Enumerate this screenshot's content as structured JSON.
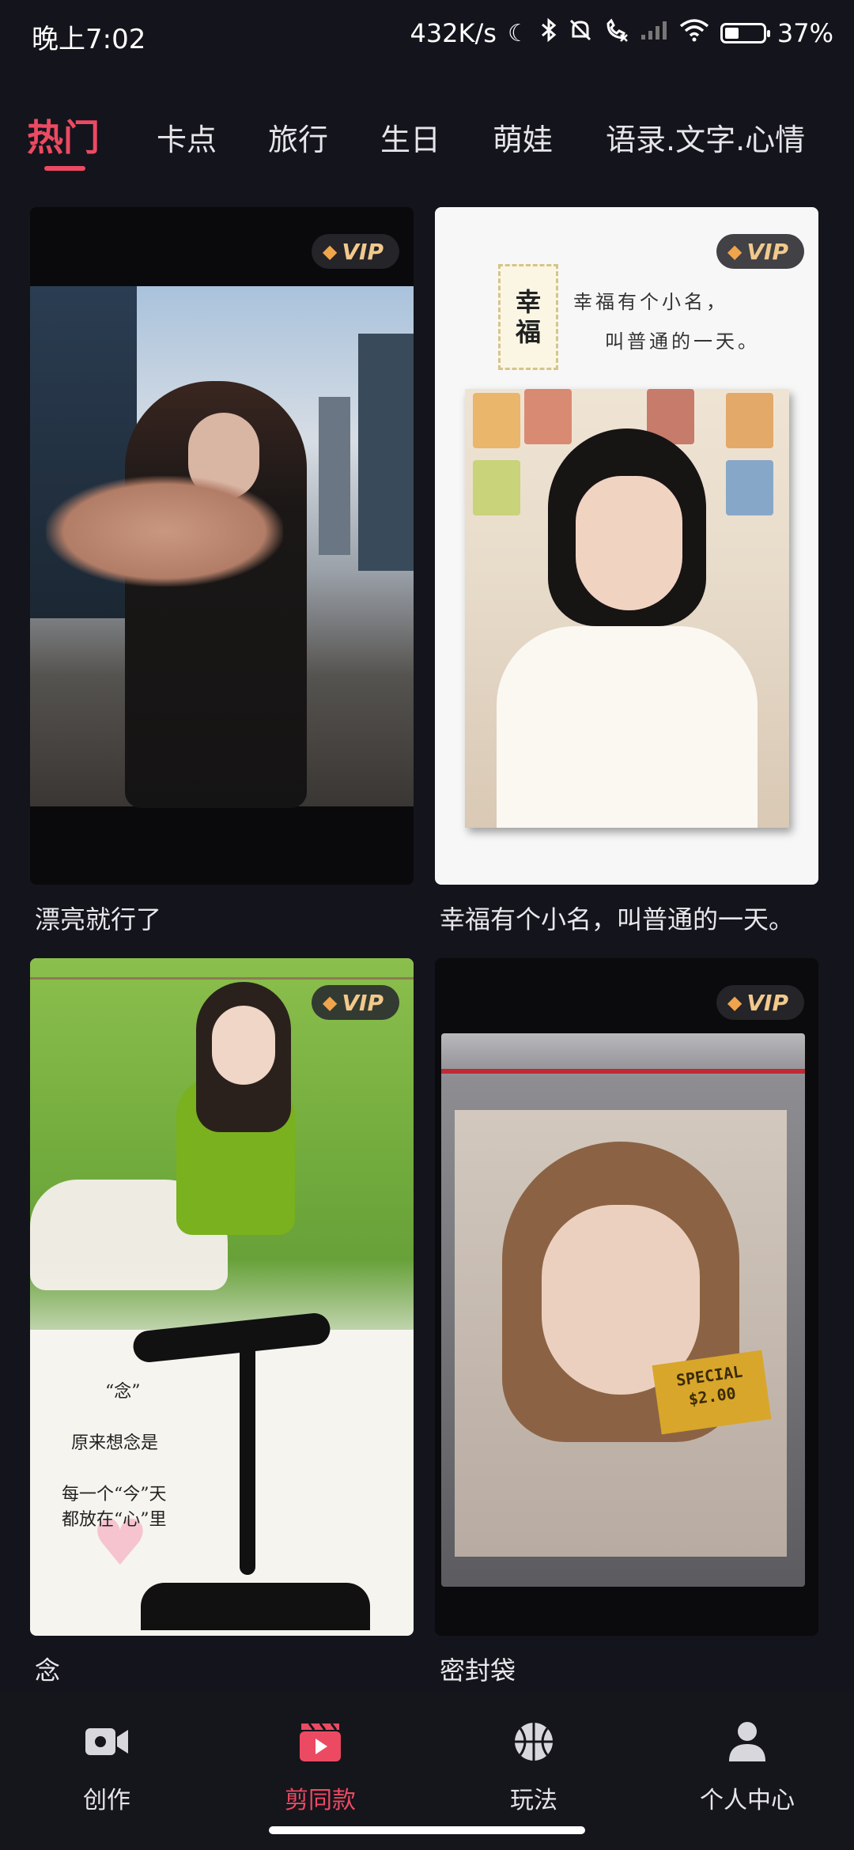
{
  "status_bar": {
    "time": "晚上7:02",
    "network_speed": "432K/s",
    "battery_percent": "37%",
    "battery_level": 0.37,
    "icons": [
      "moon-icon",
      "bluetooth-icon",
      "mute-icon",
      "call-icon",
      "signal-icon",
      "wifi-icon",
      "battery-icon"
    ]
  },
  "tabs": [
    {
      "label": "热门",
      "active": true
    },
    {
      "label": "卡点",
      "active": false
    },
    {
      "label": "旅行",
      "active": false
    },
    {
      "label": "生日",
      "active": false
    },
    {
      "label": "萌娃",
      "active": false
    },
    {
      "label": "语录.文字.心情",
      "active": false
    }
  ],
  "cards": [
    {
      "title": "漂亮就行了",
      "badge": "VIP"
    },
    {
      "title": "幸福有个小名，叫普通的一天。",
      "badge": "VIP",
      "thumb_text": {
        "stamp_top": "幸",
        "stamp_bottom": "福",
        "line1": "幸福有个小名，",
        "line2": "叫普通的一天。"
      }
    },
    {
      "title": "念",
      "badge": "VIP",
      "thumb_text": {
        "quote": "“念”",
        "line1": "原来想念是",
        "line2": "每一个“今”天",
        "line3": "都放在“心”里"
      }
    },
    {
      "title": "密封袋",
      "badge": "VIP",
      "thumb_text": {
        "sticker_line1": "SPECIAL",
        "sticker_line2": "$2.00"
      }
    }
  ],
  "bottom_nav": [
    {
      "label": "创作",
      "icon": "video-camera-icon",
      "active": false
    },
    {
      "label": "剪同款",
      "icon": "clapperboard-play-icon",
      "active": true
    },
    {
      "label": "玩法",
      "icon": "basketball-icon",
      "active": false
    },
    {
      "label": "个人中心",
      "icon": "person-icon",
      "active": false
    }
  ],
  "colors": {
    "accent": "#ec4a62",
    "background": "#14141c",
    "vip_text": "#f2c98c"
  }
}
